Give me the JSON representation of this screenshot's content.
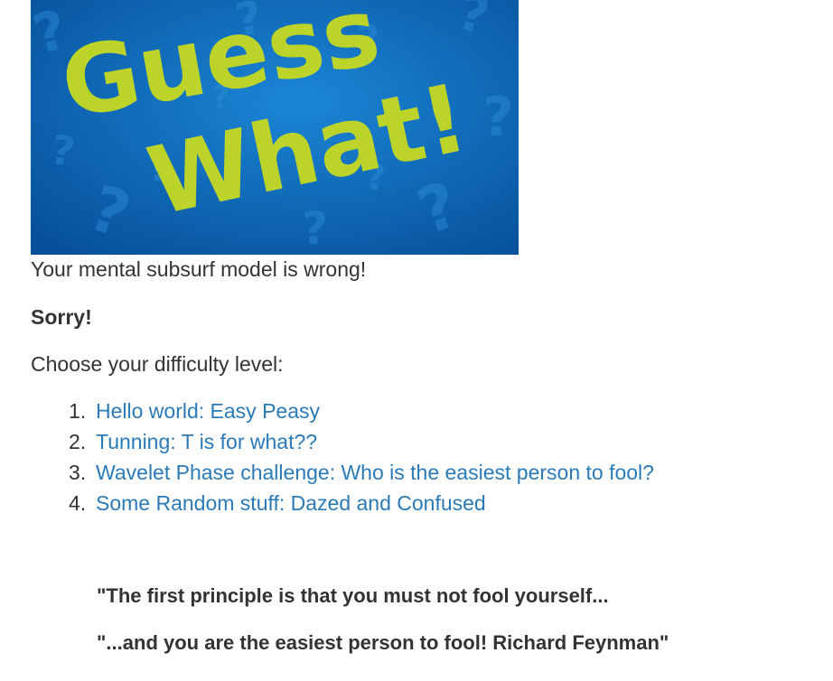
{
  "banner": {
    "logo_text_line1": "Guess",
    "logo_text_line2": "What!",
    "bg_color": "#0a63b2",
    "text_color": "#bcd42a"
  },
  "intro": {
    "subtitle": "Your mental subsurf model is wrong!",
    "sorry": "Sorry!",
    "choose": "Choose your difficulty level:"
  },
  "levels": [
    {
      "number": "1.",
      "label": "Hello world: Easy Peasy"
    },
    {
      "number": "2.",
      "label": "Tunning: T is for what??"
    },
    {
      "number": "3.",
      "label": "Wavelet Phase challenge: Who is the easiest person to fool?"
    },
    {
      "number": "4.",
      "label": "Some Random stuff: Dazed and Confused"
    }
  ],
  "quotes": {
    "line1": "\"The first principle is that you must not fool yourself...",
    "line2": "\"...and you are the easiest person to fool! Richard Feynman\""
  },
  "colors": {
    "link": "#2a7ab8",
    "text": "#333333"
  }
}
